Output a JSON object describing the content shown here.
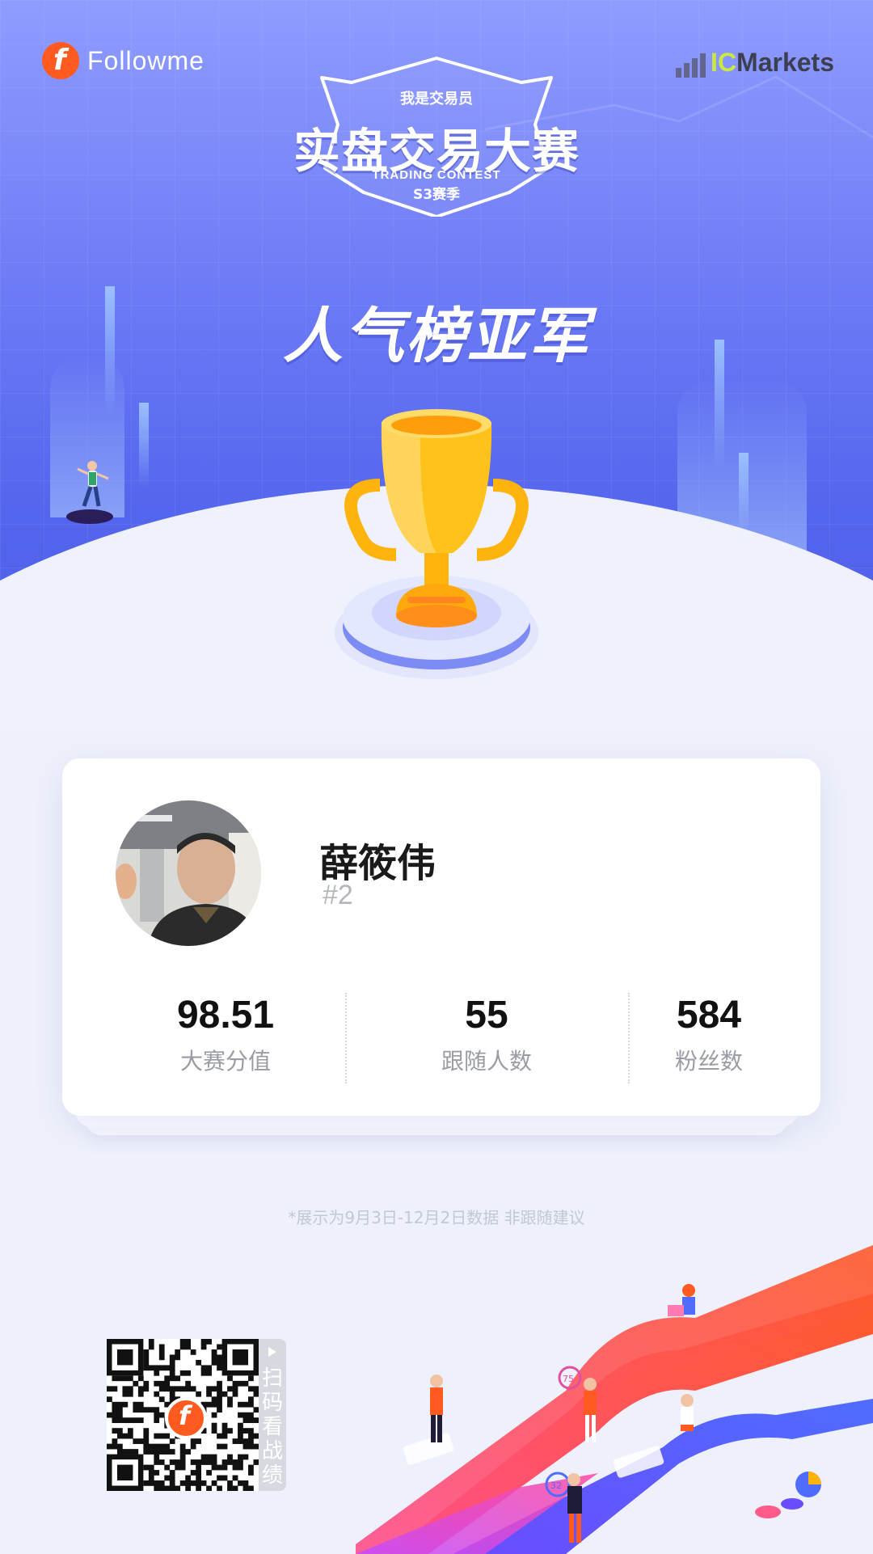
{
  "brand": {
    "left": "Followme",
    "right_prefix": "IC",
    "right_suffix": "Markets"
  },
  "contest": {
    "badge_sub": "我是交易员",
    "badge_title": "实盘交易大赛",
    "badge_en": "TRADING CONTEST",
    "badge_season": "S3赛季"
  },
  "rank_title": "人气榜亚军",
  "trader": {
    "name": "薛筱伟",
    "rank": "#2"
  },
  "stats": [
    {
      "value": "98.51",
      "label": "大赛分值"
    },
    {
      "value": "55",
      "label": "跟随人数"
    },
    {
      "value": "584",
      "label": "粉丝数"
    }
  ],
  "disclaimer": "*展示为9月3日-12月2日数据 非跟随建议",
  "qr": {
    "caption": "扫码看战绩"
  },
  "scene": {
    "badge_a": "75",
    "badge_b": "32"
  },
  "colors": {
    "brand_orange": "#ff5a1f",
    "hero_blue": "#5566ee",
    "trophy_gold": "#ffc21a"
  }
}
